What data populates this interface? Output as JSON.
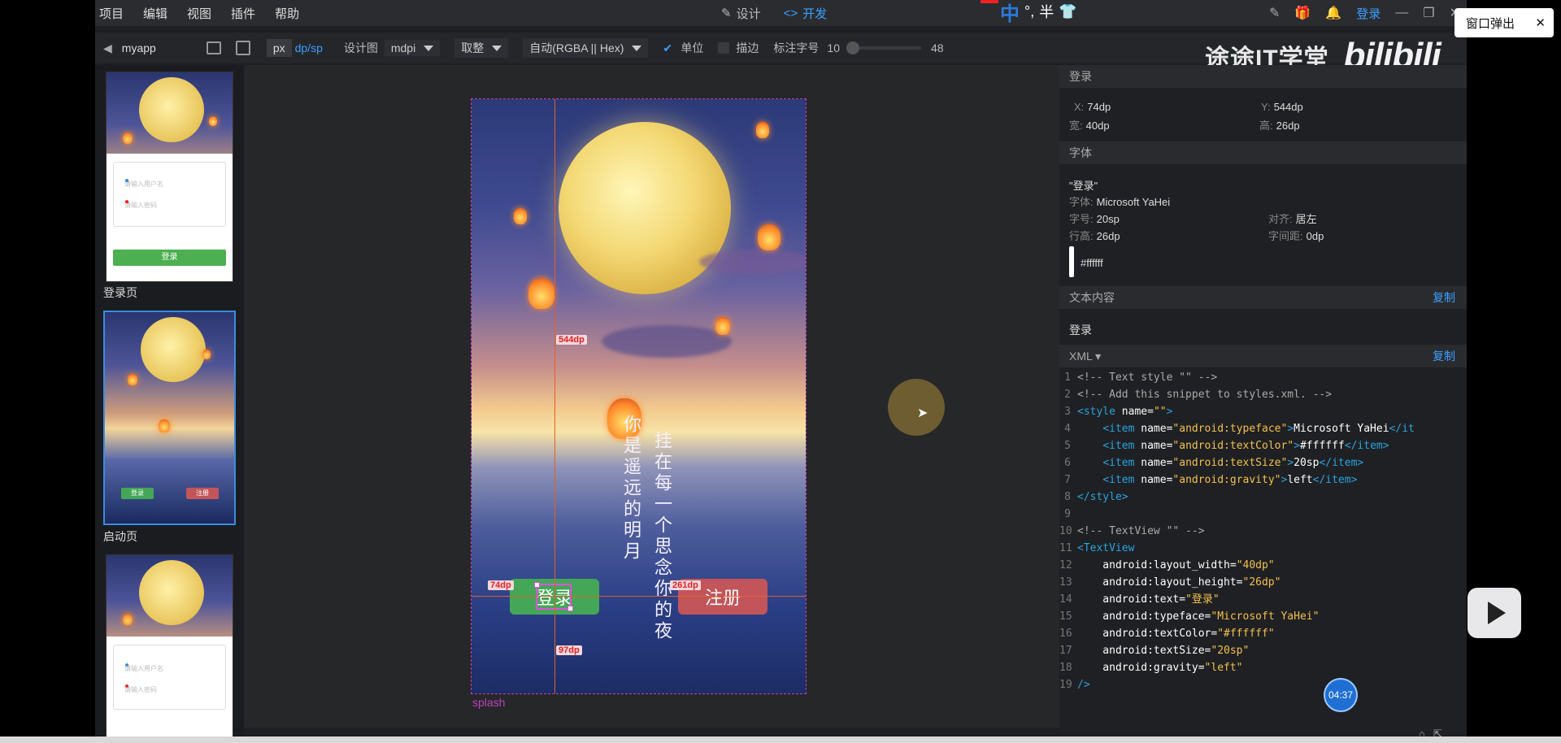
{
  "menu": [
    "项目",
    "编辑",
    "视图",
    "插件",
    "帮助"
  ],
  "mode_tabs": {
    "design": "设计",
    "develop": "开发"
  },
  "ime": {
    "lang": "中",
    "punct": "°,",
    "half": "半"
  },
  "top_login": "登录",
  "popup_button": {
    "label": "窗口弹出",
    "close": "✕"
  },
  "toolbar": {
    "back": "◀",
    "project": "myapp",
    "unit_px": "px",
    "unit_dp": "dp/sp",
    "design_label": "设计图",
    "density": "mdpi",
    "rounding": "取整",
    "color_format": "自动(RGBA || Hex)",
    "units_check": "单位",
    "stroke_check": "描边",
    "font_label": "标注字号",
    "font_min": "10",
    "font_max": "48"
  },
  "watermark": {
    "brand": "途途IT学堂",
    "bili": "bilibili"
  },
  "pages": [
    {
      "label": "登录页",
      "placeholder1": "请输入用户名",
      "placeholder2": "请输入密码",
      "button": "登录"
    },
    {
      "label": "启动页",
      "login": "登录",
      "register": "注册"
    },
    {
      "label": "",
      "placeholder1": "请输入用户名",
      "placeholder2": "请输入密码"
    }
  ],
  "artboard": {
    "name": "splash",
    "poem_col1": "你是遥远的明月",
    "poem_col2": "挂在每一个思念你的夜",
    "login": "登录",
    "register": "注册",
    "measures": {
      "top": "544dp",
      "left": "74dp",
      "right": "261dp",
      "bottom": "97dp"
    }
  },
  "props": {
    "section_login": "登录",
    "x_label": "X:",
    "x": "74dp",
    "y_label": "Y:",
    "y": "544dp",
    "w_label": "宽:",
    "w": "40dp",
    "h_label": "高:",
    "h": "26dp",
    "section_font": "字体",
    "font_text": "\"登录\"",
    "font_face_label": "字体:",
    "font_face": "Microsoft YaHei",
    "font_size_label": "字号:",
    "font_size": "20sp",
    "align_label": "对齐:",
    "align": "居左",
    "line_h_label": "行高:",
    "line_h": "26dp",
    "spacing_label": "字间距:",
    "spacing": "0dp",
    "color": "#ffffff",
    "section_text": "文本内容",
    "copy": "复制",
    "text_content": "登录",
    "section_xml": "XML ▾"
  },
  "code_lines": [
    [
      [
        "c-com",
        "<!-- Text style \"\" -->"
      ]
    ],
    [
      [
        "c-com",
        "<!-- Add this snippet to styles.xml. -->"
      ]
    ],
    [
      [
        "c-tag",
        "<style "
      ],
      [
        "c-attr",
        "name="
      ],
      [
        "c-val",
        "\"\""
      ],
      [
        "c-tag",
        ">"
      ]
    ],
    [
      [
        "c-attr",
        "    "
      ],
      [
        "c-tag",
        "<item "
      ],
      [
        "c-attr",
        "name="
      ],
      [
        "c-val",
        "\"android:typeface\""
      ],
      [
        "c-tag",
        ">"
      ],
      [
        "c-attr",
        "Microsoft YaHei"
      ],
      [
        "c-tag",
        "</it"
      ]
    ],
    [
      [
        "c-attr",
        "    "
      ],
      [
        "c-tag",
        "<item "
      ],
      [
        "c-attr",
        "name="
      ],
      [
        "c-val",
        "\"android:textColor\""
      ],
      [
        "c-tag",
        ">"
      ],
      [
        "c-attr",
        "#ffffff"
      ],
      [
        "c-tag",
        "</item>"
      ]
    ],
    [
      [
        "c-attr",
        "    "
      ],
      [
        "c-tag",
        "<item "
      ],
      [
        "c-attr",
        "name="
      ],
      [
        "c-val",
        "\"android:textSize\""
      ],
      [
        "c-tag",
        ">"
      ],
      [
        "c-attr",
        "20sp"
      ],
      [
        "c-tag",
        "</item>"
      ]
    ],
    [
      [
        "c-attr",
        "    "
      ],
      [
        "c-tag",
        "<item "
      ],
      [
        "c-attr",
        "name="
      ],
      [
        "c-val",
        "\"android:gravity\""
      ],
      [
        "c-tag",
        ">"
      ],
      [
        "c-attr",
        "left"
      ],
      [
        "c-tag",
        "</item>"
      ]
    ],
    [
      [
        "c-tag",
        "</style>"
      ]
    ],
    [
      [
        "c-attr",
        ""
      ]
    ],
    [
      [
        "c-com",
        "<!-- TextView \"\" -->"
      ]
    ],
    [
      [
        "c-tag",
        "<TextView"
      ]
    ],
    [
      [
        "c-attr",
        "    android:layout_width="
      ],
      [
        "c-val",
        "\"40dp\""
      ]
    ],
    [
      [
        "c-attr",
        "    android:layout_height="
      ],
      [
        "c-val",
        "\"26dp\""
      ]
    ],
    [
      [
        "c-attr",
        "    android:text="
      ],
      [
        "c-val",
        "\"登录\""
      ]
    ],
    [
      [
        "c-attr",
        "    android:typeface="
      ],
      [
        "c-val",
        "\"Microsoft YaHei\""
      ]
    ],
    [
      [
        "c-attr",
        "    android:textColor="
      ],
      [
        "c-val",
        "\"#ffffff\""
      ]
    ],
    [
      [
        "c-attr",
        "    android:textSize="
      ],
      [
        "c-val",
        "\"20sp\""
      ]
    ],
    [
      [
        "c-attr",
        "    android:gravity="
      ],
      [
        "c-val",
        "\"left\""
      ]
    ],
    [
      [
        "c-tag",
        "/>"
      ]
    ]
  ],
  "video_time": "04:37",
  "colors": {
    "accent": "#3aa0ff",
    "login_green": "#43a757",
    "register_red": "#c2555a",
    "guide": "#e0602a",
    "artboard_border": "#c040c0"
  }
}
